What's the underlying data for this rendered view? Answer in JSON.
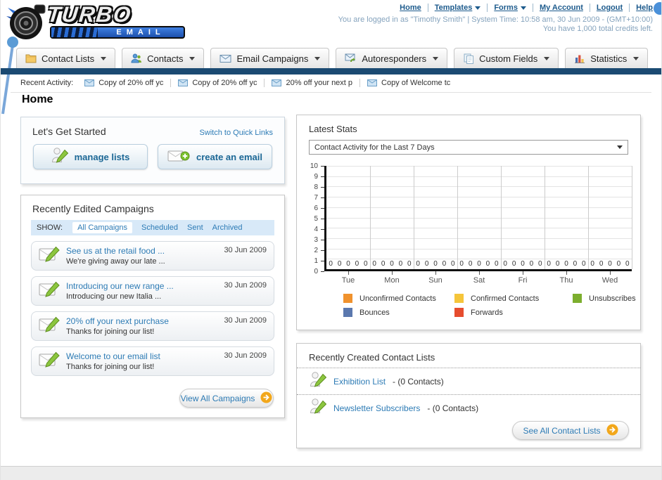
{
  "header": {
    "logo_line1": "TURBO",
    "logo_line2": "EMAIL",
    "nav_links": [
      {
        "label": "Home",
        "dropdown": false
      },
      {
        "label": "Templates",
        "dropdown": true
      },
      {
        "label": "Forms",
        "dropdown": true
      },
      {
        "label": "My Account",
        "dropdown": false
      },
      {
        "label": "Logout",
        "dropdown": false
      },
      {
        "label": "Help",
        "dropdown": false
      }
    ],
    "login_info": "You are logged in as \"Timothy Smith\" | System Time: 10:58 am, 30 Jun 2009 - (GMT+10:00)",
    "credits_info": "You have 1,000 total credits left."
  },
  "nav_tabs": [
    {
      "id": "contact-lists",
      "label": "Contact Lists",
      "icon": "folder-icon"
    },
    {
      "id": "contacts",
      "label": "Contacts",
      "icon": "contacts-icon"
    },
    {
      "id": "email-campaigns",
      "label": "Email Campaigns",
      "icon": "envelope-icon"
    },
    {
      "id": "autoresponders",
      "label": "Autoresponders",
      "icon": "autoresponder-icon"
    },
    {
      "id": "custom-fields",
      "label": "Custom Fields",
      "icon": "fields-icon"
    },
    {
      "id": "statistics",
      "label": "Statistics",
      "icon": "barchart-icon"
    }
  ],
  "recent_activity": {
    "label": "Recent Activity:",
    "items": [
      "Copy of 20% off yc",
      "Copy of 20% off yc",
      "20% off your next p",
      "Copy of Welcome tc"
    ]
  },
  "page_title": "Home",
  "get_started": {
    "title": "Let's Get Started",
    "switch_link": "Switch to Quick Links",
    "manage_lists_label": "manage lists",
    "create_email_label": "create an email"
  },
  "campaigns": {
    "title": "Recently Edited Campaigns",
    "show_label": "SHOW:",
    "filters": [
      "All Campaigns",
      "Scheduled",
      "Sent",
      "Archived"
    ],
    "active_filter": "All Campaigns",
    "items": [
      {
        "title": "See us at the retail food ...",
        "subtitle": "We're giving away our late ...",
        "date": "30 Jun 2009"
      },
      {
        "title": "Introducing our new range ...",
        "subtitle": "Introducing our new Italia ...",
        "date": "30 Jun 2009"
      },
      {
        "title": "20% off your next purchase",
        "subtitle": "Thanks for joining our list!",
        "date": "30 Jun 2009"
      },
      {
        "title": "Welcome to our email list",
        "subtitle": "Thanks for joining our list!",
        "date": "30 Jun 2009"
      }
    ],
    "view_all_label": "View All Campaigns"
  },
  "latest_stats": {
    "title": "Latest Stats",
    "dropdown_value": "Contact Activity for the Last 7 Days"
  },
  "chart_data": {
    "type": "bar",
    "title": "Contact Activity for the Last 7 Days",
    "categories": [
      "Tue",
      "Mon",
      "Sun",
      "Sat",
      "Fri",
      "Thu",
      "Wed"
    ],
    "series": [
      {
        "name": "Unconfirmed Contacts",
        "color": "#F0922D",
        "values": [
          0,
          0,
          0,
          0,
          0,
          0,
          0
        ]
      },
      {
        "name": "Confirmed Contacts",
        "color": "#F5C53A",
        "values": [
          0,
          0,
          0,
          0,
          0,
          0,
          0
        ]
      },
      {
        "name": "Unsubscribes",
        "color": "#7CAE2E",
        "values": [
          0,
          0,
          0,
          0,
          0,
          0,
          0
        ]
      },
      {
        "name": "Bounces",
        "color": "#5B78AE",
        "values": [
          0,
          0,
          0,
          0,
          0,
          0,
          0
        ]
      },
      {
        "name": "Forwards",
        "color": "#E64C2E",
        "values": [
          0,
          0,
          0,
          0,
          0,
          0,
          0
        ]
      }
    ],
    "xlabel": "",
    "ylabel": "",
    "ylim": [
      0,
      10
    ],
    "yticks": [
      0,
      1,
      2,
      3,
      4,
      5,
      6,
      7,
      8,
      9,
      10
    ],
    "grid": true,
    "legend_position": "bottom"
  },
  "contact_lists": {
    "title": "Recently Created Contact Lists",
    "items": [
      {
        "name": "Exhibition List",
        "detail": "- (0 Contacts)"
      },
      {
        "name": "Newsletter Subscribers",
        "detail": "- (0 Contacts)"
      }
    ],
    "see_all_label": "See All Contact Lists"
  },
  "colors": {
    "navy_bar": "#1B4A72",
    "link": "#2D7BB5",
    "accent_orange": "#F2A71B"
  }
}
